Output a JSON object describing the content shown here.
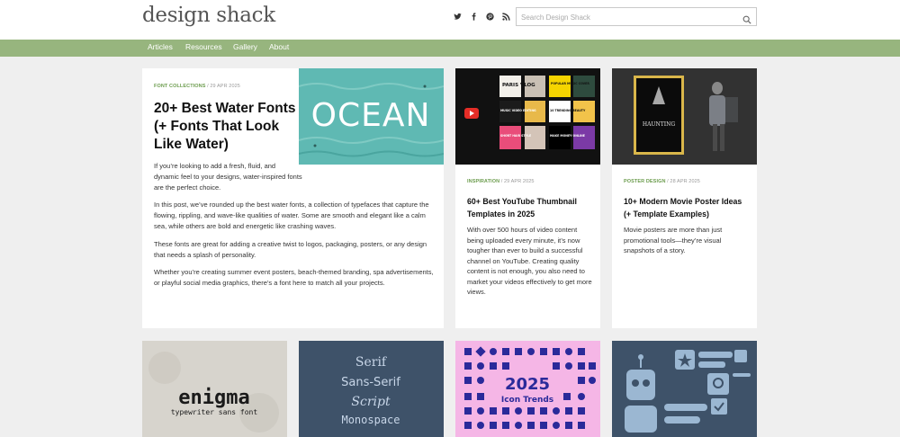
{
  "header": {
    "logo": "design shack",
    "social_icons": [
      "twitter-icon",
      "facebook-icon",
      "pinterest-icon",
      "rss-icon"
    ],
    "search_placeholder": "Search Design Shack"
  },
  "nav": {
    "items": [
      {
        "label": "Articles"
      },
      {
        "label": "Resources"
      },
      {
        "label": "Gallery"
      },
      {
        "label": "About"
      }
    ]
  },
  "featured": {
    "category": "FONT COLLECTIONS",
    "date": " / 29 APR 2025",
    "title": "20+ Best Water Fonts (+ Fonts That Look Like Water)",
    "thumb_text": "OCEAN",
    "intro": "If you’re looking to add a fresh, fluid, and dynamic feel to your designs, water-inspired fonts are the perfect choice.",
    "paragraphs": [
      "In this post, we’ve rounded up the best water fonts, a collection of typefaces that capture the flowing, rippling, and wave-like qualities of water. Some are smooth and elegant like a calm sea, while others are bold and energetic like crashing waves.",
      "These fonts are great for adding a creative twist to logos, packaging, posters, or any design that needs a splash of personality.",
      "Whether you’re creating summer event posters, beach-themed branding, spa advertisements, or playful social media graphics, there’s a font here to match all your projects."
    ]
  },
  "cards": [
    {
      "category": "INSPIRATION",
      "date": " / 29 APR 2025",
      "title": "60+ Best YouTube Thumbnail Templates in 2025",
      "text": "With over 500 hours of video content being uploaded every minute, it’s now tougher than ever to build a successful channel on YouTube. Creating quality content is not enough, you also need to market your videos effectively to get more views.",
      "thumb_labels": [
        "PARIS VLOG",
        "POPULAR MUSIC COVER",
        "MUSIC VIDEO EDITING",
        "10 TRENDING BEAUTY",
        "SHORT HAIR STYLE",
        "MAKE MONEY ONLINE"
      ]
    },
    {
      "category": "POSTER DESIGN",
      "date": " / 28 APR 2025",
      "title": "10+ Modern Movie Poster Ideas (+ Template Examples)",
      "text": "Movie posters are more than just promotional tools—they’re visual snapshots of a story.",
      "thumb_labels": [
        "HAUNTING"
      ]
    }
  ],
  "row2": {
    "enigma": {
      "title": "enigma",
      "subtitle": "typewriter sans font"
    },
    "styles": {
      "lines": [
        "Serif",
        "Sans-Serif",
        "Script",
        "Monospace"
      ]
    },
    "icons": {
      "year": "2025",
      "label": "Icon Trends"
    }
  },
  "colors": {
    "nav_bg": "#97b57e",
    "accent_green": "#6d9d4f",
    "ocean": "#5fb9b3",
    "slate": "#3e5269",
    "pink": "#f5b6e6"
  }
}
